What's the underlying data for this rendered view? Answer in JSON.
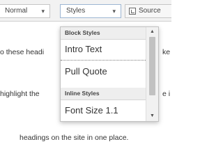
{
  "toolbar": {
    "format_combo": {
      "value": "Normal",
      "arrow": "▾"
    },
    "styles_combo": {
      "value": "Styles",
      "arrow": "▾"
    },
    "source_button": {
      "label": "Source",
      "icon": "source-icon"
    }
  },
  "content": {
    "lines": [
      "o these headi",
      "highlight the",
      "headings on the site in one place."
    ],
    "right_fragments": [
      "ke",
      "e i"
    ]
  },
  "styles_dropdown": {
    "groups": [
      {
        "title": "Block Styles",
        "items": [
          "Intro Text",
          "Pull Quote"
        ]
      },
      {
        "title": "Inline Styles",
        "items": [
          "Font Size 1.1"
        ]
      }
    ],
    "scrollbar": {
      "up": "▲",
      "down": "▼"
    }
  }
}
